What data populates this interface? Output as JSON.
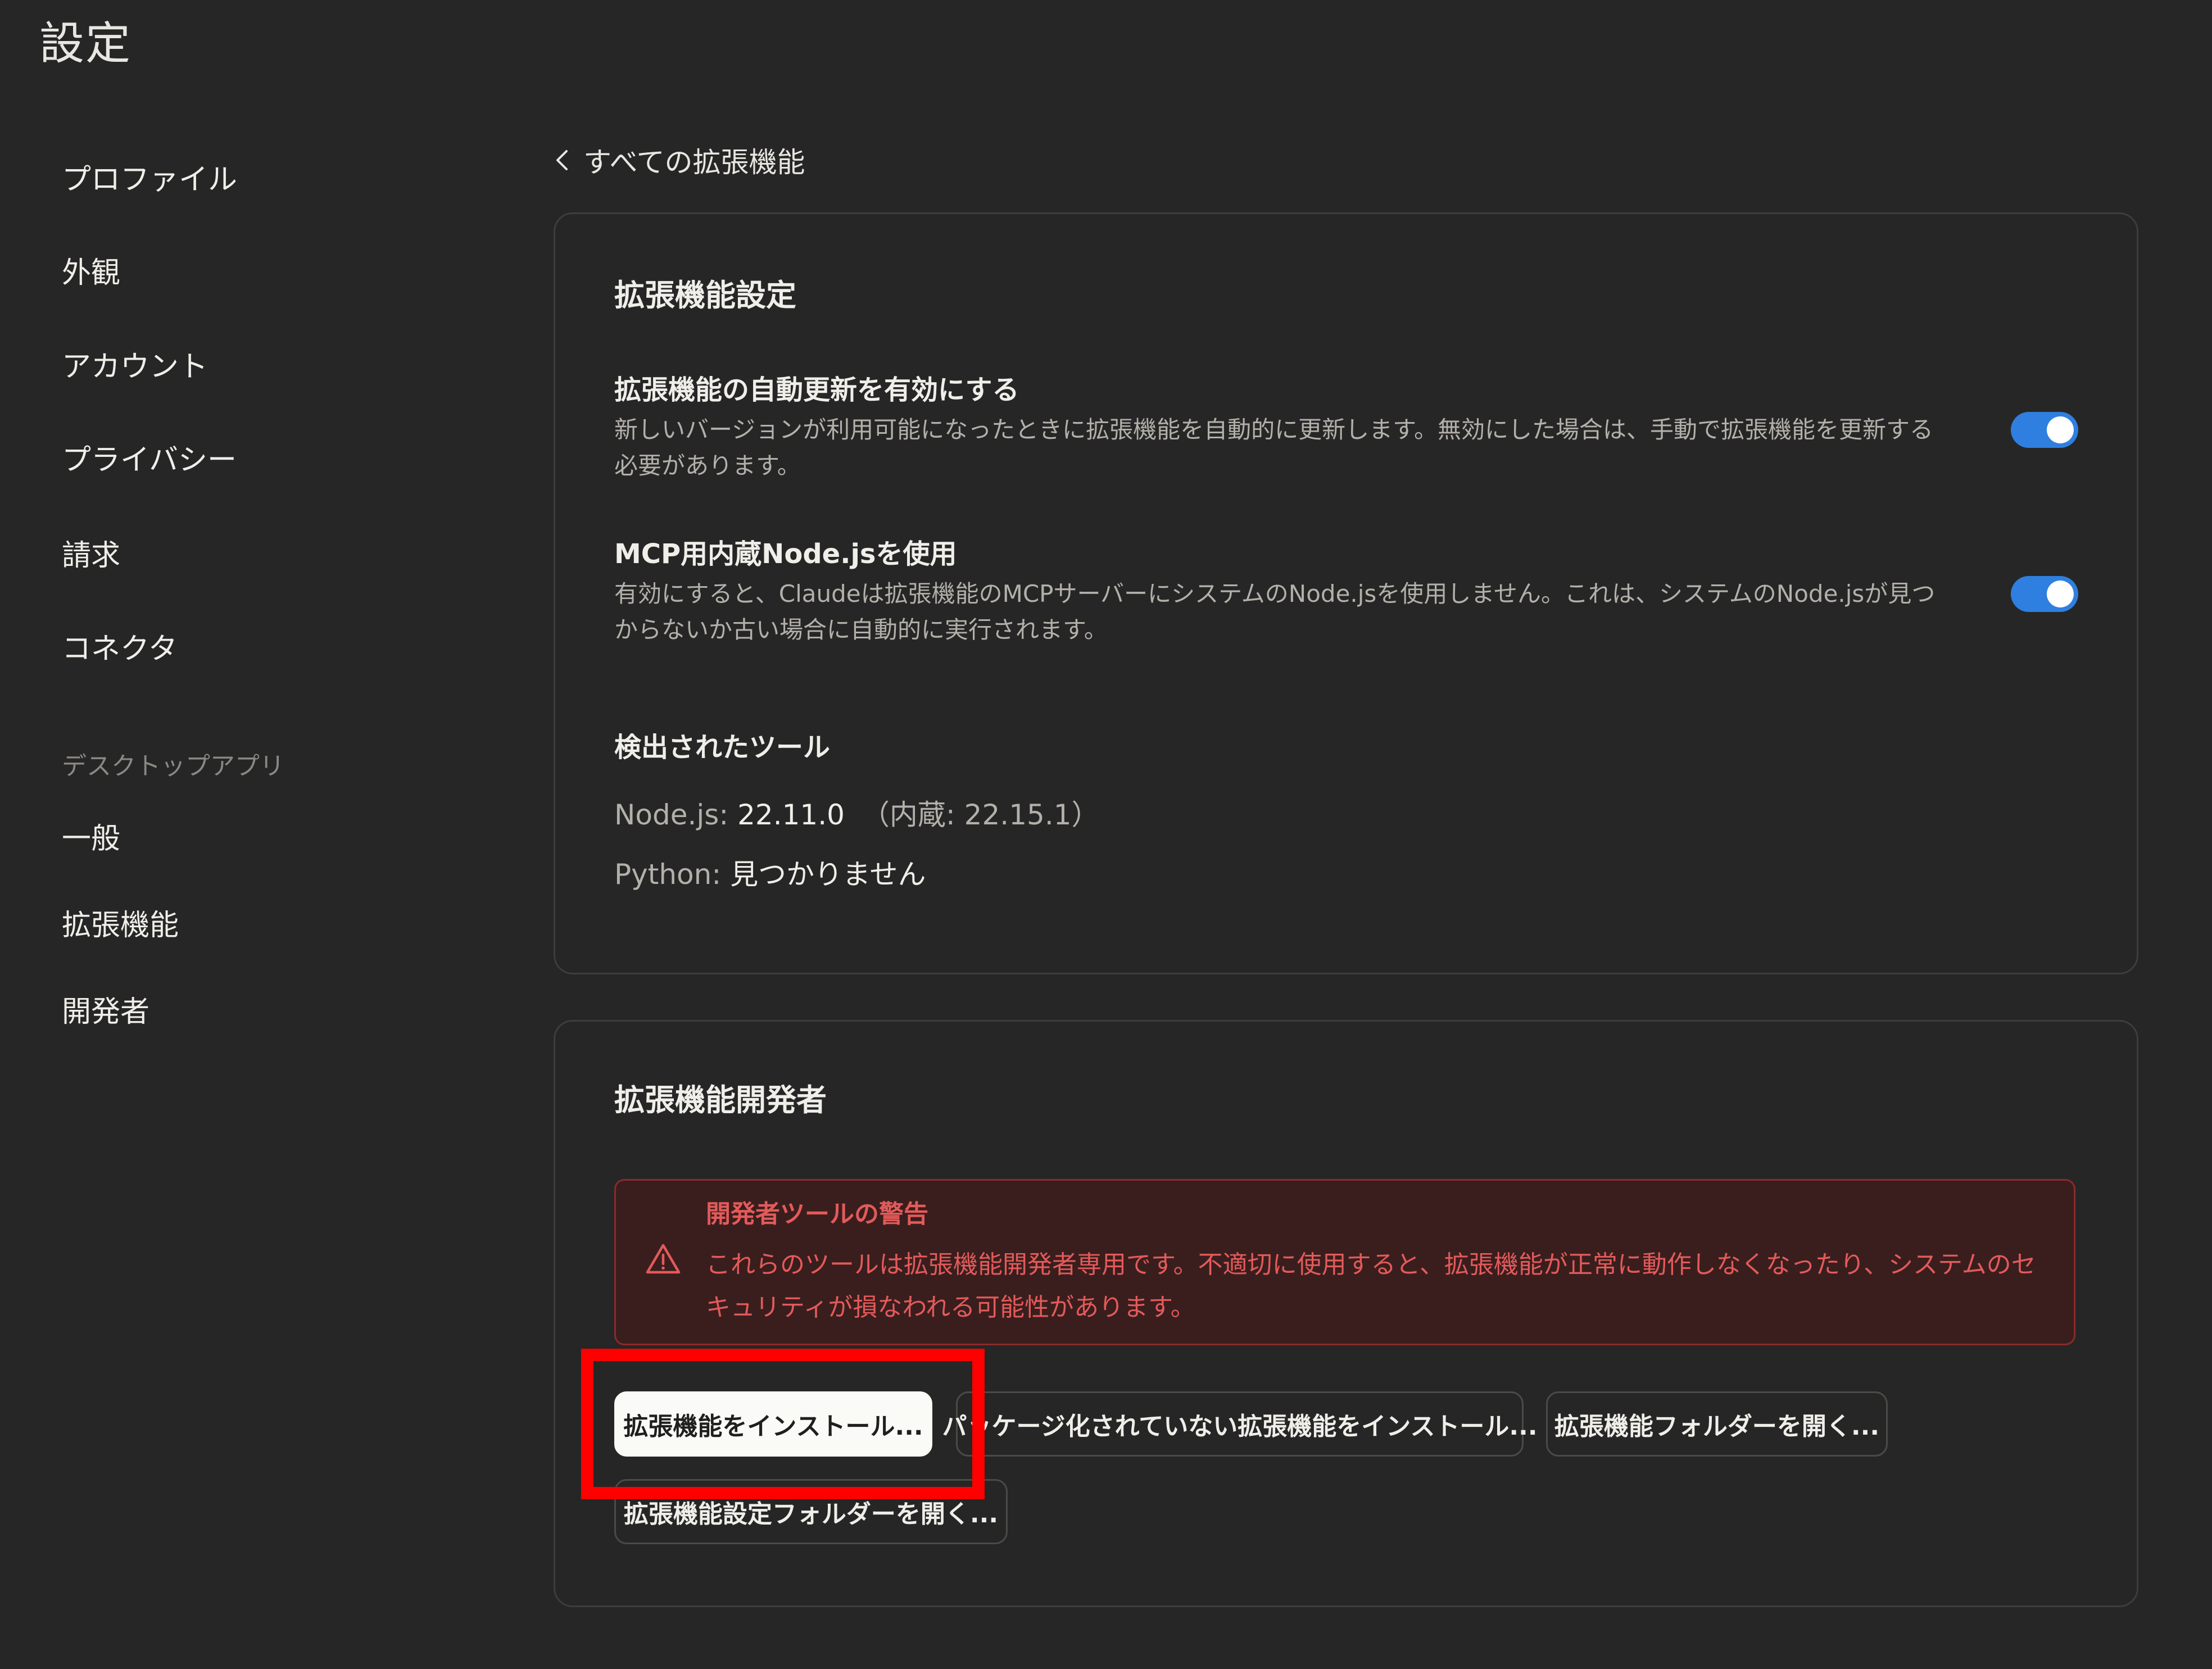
{
  "header": {
    "title": "設定"
  },
  "sidebar": {
    "items": [
      {
        "label": "プロファイル"
      },
      {
        "label": "外観"
      },
      {
        "label": "アカウント"
      },
      {
        "label": "プライバシー"
      },
      {
        "label": "請求"
      },
      {
        "label": "コネクタ"
      }
    ],
    "section_label": "デスクトップアプリ",
    "app_items": [
      {
        "label": "一般"
      },
      {
        "label": "拡張機能"
      },
      {
        "label": "開発者"
      }
    ]
  },
  "back_link": {
    "label": "すべての拡張機能"
  },
  "extension_settings": {
    "title": "拡張機能設定",
    "auto_update": {
      "title": "拡張機能の自動更新を有効にする",
      "description": "新しいバージョンが利用可能になったときに拡張機能を自動的に更新します。無効にした場合は、手動で拡張機能を更新する必要があります。",
      "enabled": true
    },
    "builtin_node": {
      "title": "MCP用内蔵Node.jsを使用",
      "description": "有効にすると、Claudeは拡張機能のMCPサーバーにシステムのNode.jsを使用しません。これは、システムのNode.jsが見つからないか古い場合に自動的に実行されます。",
      "enabled": true
    },
    "detected_tools": {
      "title": "検出されたツール",
      "node_label": "Node.js: ",
      "node_value": "22.11.0",
      "node_extra": "（内蔵: 22.15.1）",
      "python_label": "Python: ",
      "python_value": "見つかりません"
    }
  },
  "extension_developer": {
    "title": "拡張機能開発者",
    "warning": {
      "title": "開発者ツールの警告",
      "text": "これらのツールは拡張機能開発者専用です。不適切に使用すると、拡張機能が正常に動作しなくなったり、システムのセキュリティが損なわれる可能性があります。"
    },
    "buttons": {
      "install": "拡張機能をインストール...",
      "install_unpacked": "パッケージ化されていない拡張機能をインストール...",
      "open_folder": "拡張機能フォルダーを開く...",
      "open_settings_folder": "拡張機能設定フォルダーを開く..."
    }
  },
  "colors": {
    "background": "#262626",
    "toggle_on": "#2f7fe0",
    "warning": "#e35a5a",
    "highlight": "#ff0000"
  }
}
